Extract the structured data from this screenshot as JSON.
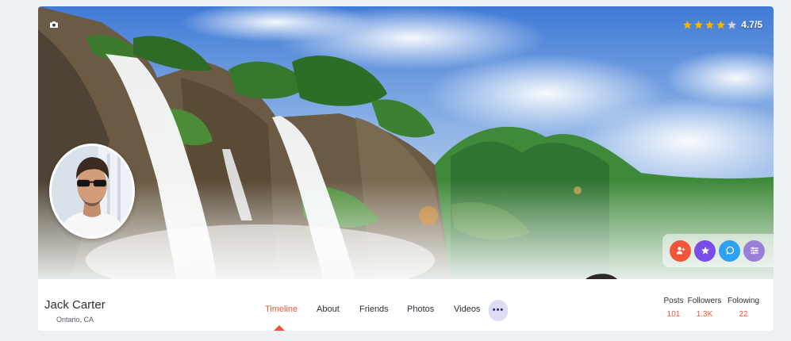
{
  "profile": {
    "name": "Jack Carter",
    "location": "Ontario, CA"
  },
  "rating": {
    "score_text": "4.7/5",
    "stars_total": 5,
    "stars_filled": 4,
    "star_color": "#f5b400",
    "empty_star_color": "#cfd3da"
  },
  "tabs": [
    {
      "label": "Timeline",
      "active": true
    },
    {
      "label": "About",
      "active": false
    },
    {
      "label": "Friends",
      "active": false
    },
    {
      "label": "Photos",
      "active": false
    },
    {
      "label": "Videos",
      "active": false
    }
  ],
  "more_button": {
    "label": "•••",
    "icon": "more-dots-icon"
  },
  "stats": [
    {
      "label": "Posts",
      "value": "101"
    },
    {
      "label": "Followers",
      "value": "1.3K"
    },
    {
      "label": "Folowing",
      "value": "22"
    }
  ],
  "action_buttons": [
    {
      "icon": "add-friend-icon",
      "color": "#f1553a"
    },
    {
      "icon": "star-icon",
      "color": "#7a4de8"
    },
    {
      "icon": "chat-icon",
      "color": "#2ea1f0"
    },
    {
      "icon": "settings-sliders-icon",
      "color": "#9a7fd8"
    }
  ],
  "cover": {
    "icon": "camera-icon"
  },
  "colors": {
    "accent": "#f1553a",
    "page_background": "#edf1f6"
  }
}
